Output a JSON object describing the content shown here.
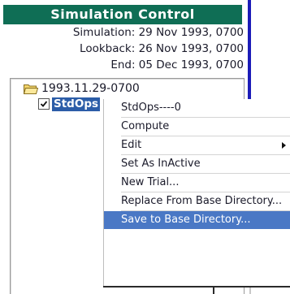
{
  "simulation_control": {
    "title": "Simulation Control",
    "simulation": "Simulation: 29 Nov 1993, 0700",
    "lookback": "Lookback: 26 Nov 1993, 0700",
    "end": "End: 05 Dec 1993, 0700"
  },
  "tree": {
    "root_label": "1993.11.29-0700",
    "child_label": "StdOps",
    "child_checked": true
  },
  "context_menu": {
    "items": [
      {
        "label": "StdOps----0"
      },
      {
        "label": "Compute"
      },
      {
        "label": "Edit",
        "has_submenu": true
      },
      {
        "label": "Set As InActive"
      },
      {
        "label": "New Trial..."
      },
      {
        "label": "Replace From Base Directory..."
      },
      {
        "label": "Save to Base Directory..."
      }
    ],
    "selected_index": 6
  },
  "colors": {
    "title_bar": "#0f6e55",
    "selection": "#4a78c5",
    "tree_selection": "#2c5da8",
    "divider": "#1c1cb8"
  }
}
